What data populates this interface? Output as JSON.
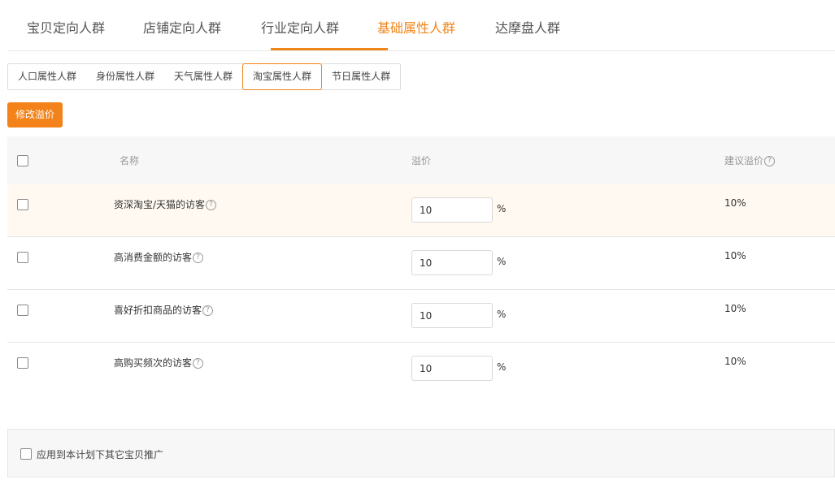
{
  "top_tabs": [
    {
      "label": "宝贝定向人群",
      "active": false
    },
    {
      "label": "店铺定向人群",
      "active": false
    },
    {
      "label": "行业定向人群",
      "active": false
    },
    {
      "label": "基础属性人群",
      "active": true
    },
    {
      "label": "达摩盘人群",
      "active": false
    }
  ],
  "sub_tabs": [
    {
      "label": "人口属性人群",
      "active": false
    },
    {
      "label": "身份属性人群",
      "active": false
    },
    {
      "label": "天气属性人群",
      "active": false
    },
    {
      "label": "淘宝属性人群",
      "active": true
    },
    {
      "label": "节日属性人群",
      "active": false
    }
  ],
  "toolbar": {
    "modify_label": "修改溢价"
  },
  "table": {
    "headers": {
      "name": "名称",
      "premium": "溢价",
      "suggested": "建议溢价"
    },
    "rows": [
      {
        "name": "资深淘宝/天猫的访客",
        "premium": "10",
        "unit": "%",
        "suggested": "10%"
      },
      {
        "name": "高消费金额的访客",
        "premium": "10",
        "unit": "%",
        "suggested": "10%"
      },
      {
        "name": "喜好折扣商品的访客",
        "premium": "10",
        "unit": "%",
        "suggested": "10%"
      },
      {
        "name": "高购买频次的访客",
        "premium": "10",
        "unit": "%",
        "suggested": "10%"
      }
    ]
  },
  "footer": {
    "apply_label": "应用到本计划下其它宝贝推广"
  },
  "icons": {
    "help": "question-circle-icon"
  },
  "colors": {
    "accent": "#f08519",
    "button": "#f3821a",
    "highlight_row": "#fff9f2"
  }
}
